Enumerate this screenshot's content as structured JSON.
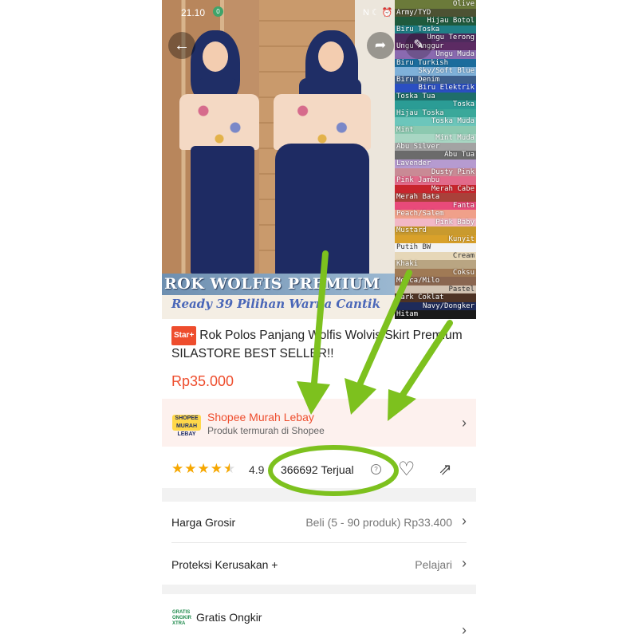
{
  "status_bar": {
    "time": "21.10",
    "notif": "0",
    "system_icons": "N ☾ ⏰"
  },
  "hero": {
    "banner_title": "ROK WOLFIS PREMIUM",
    "banner_tagline": "Ready 39 Pilihan Warna Cantik",
    "color_swatches": [
      {
        "label": "Olive",
        "color": "#6b7a3a"
      },
      {
        "label": "Army/TYD",
        "color": "#4d5233"
      },
      {
        "label": "Hijau Botol",
        "color": "#1f5a3d"
      },
      {
        "label": "Biru Toska",
        "color": "#1f7f86"
      },
      {
        "label": "Ungu Terong",
        "color": "#4e2b5e"
      },
      {
        "label": "Ungu Anggur",
        "color": "#5c2b63"
      },
      {
        "label": "Ungu Muda",
        "color": "#8a6ab0"
      },
      {
        "label": "Biru Turkish",
        "color": "#1c6c9c"
      },
      {
        "label": "Sky/Soft Blue",
        "color": "#7fb1d9"
      },
      {
        "label": "Biru Denim",
        "color": "#3d5f8c"
      },
      {
        "label": "Biru Elektrik",
        "color": "#2b4fc2"
      },
      {
        "label": "Toska Tua",
        "color": "#1f6e6a"
      },
      {
        "label": "Toska",
        "color": "#2b9c95"
      },
      {
        "label": "Hijau Toska",
        "color": "#3aa89a"
      },
      {
        "label": "Toska Muda",
        "color": "#6cc6bb"
      },
      {
        "label": "Mint",
        "color": "#8cc9b0"
      },
      {
        "label": "Mint Muda",
        "color": "#a8d6c3"
      },
      {
        "label": "Abu Silver",
        "color": "#a3a3a3"
      },
      {
        "label": "Abu Tua",
        "color": "#6b6b6b"
      },
      {
        "label": "Lavender",
        "color": "#b69bd0"
      },
      {
        "label": "Dusty Pink",
        "color": "#c98a95"
      },
      {
        "label": "Pink Jambu",
        "color": "#e26a8a"
      },
      {
        "label": "Merah Cabe",
        "color": "#c8252d"
      },
      {
        "label": "Merah Bata",
        "color": "#a9413a"
      },
      {
        "label": "Fanta",
        "color": "#e84a7a"
      },
      {
        "label": "Peach/Salem",
        "color": "#f0a08a"
      },
      {
        "label": "Pink Baby",
        "color": "#f2b8c6"
      },
      {
        "label": "Mustard",
        "color": "#c99a2e"
      },
      {
        "label": "Kunyit",
        "color": "#d9a12a"
      },
      {
        "label": "Putih BW",
        "color": "#f3f3f3"
      },
      {
        "label": "Cream",
        "color": "#e6d7b8"
      },
      {
        "label": "Khaki",
        "color": "#b9a582"
      },
      {
        "label": "Coksu",
        "color": "#a07a55"
      },
      {
        "label": "Mocca/Milo",
        "color": "#8a6650"
      },
      {
        "label": "Pastel",
        "color": "#d2c3b3"
      },
      {
        "label": "Dark Coklat",
        "color": "#4e3325"
      },
      {
        "label": "Navy/Dongker",
        "color": "#1e2b5a"
      },
      {
        "label": "Hitam",
        "color": "#1a1a1a"
      }
    ]
  },
  "product": {
    "badge": "Star+",
    "title": "Rok Polos Panjang Wolfis Wolvis Skirt Premium SILASTORE BEST SELLER!!",
    "price": "Rp35.000"
  },
  "promo": {
    "logo_text": "SHOPEE MURAH LEBAY",
    "name": "Shopee Murah Lebay",
    "subtitle": "Produk termurah di Shopee"
  },
  "rating": {
    "stars": 4.5,
    "score": "4.9",
    "sold": "366692 Terjual"
  },
  "rows": {
    "grosir_label": "Harga Grosir",
    "grosir_value": "Beli (5 - 90 produk) Rp33.400",
    "proteksi_label": "Proteksi Kerusakan +",
    "proteksi_value": "Pelajari",
    "shipping_icon": "GRATIS ONGKIR XTRA",
    "shipping_label": "Gratis Ongkir"
  },
  "colors": {
    "accent": "#ee4d2d",
    "annotation": "#7dc11e",
    "star": "#f6a700"
  }
}
